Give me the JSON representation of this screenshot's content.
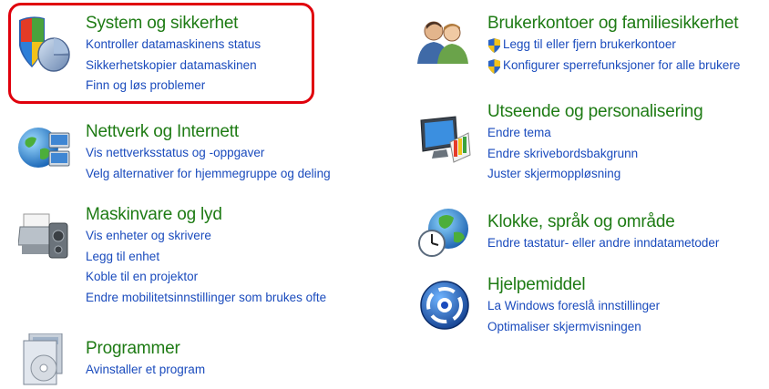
{
  "categories": [
    {
      "id": "system",
      "icon": "shield-icon",
      "title": "System og sikkerhet",
      "links": [
        "Kontroller datamaskinens status",
        "Sikkerhetskopier datamaskinen",
        "Finn og løs problemer"
      ]
    },
    {
      "id": "network",
      "icon": "network-globe-icon",
      "title": "Nettverk og Internett",
      "links": [
        "Vis nettverksstatus og -oppgaver",
        "Velg alternativer for hjemmegruppe og deling"
      ]
    },
    {
      "id": "hardware",
      "icon": "printer-speaker-icon",
      "title": "Maskinvare og lyd",
      "links": [
        "Vis enheter og skrivere",
        "Legg til enhet",
        "Koble til en projektor",
        "Endre mobilitetsinnstillinger som brukes ofte"
      ]
    },
    {
      "id": "programs",
      "icon": "programs-disc-icon",
      "title": "Programmer",
      "links": [
        "Avinstaller et program"
      ]
    },
    {
      "id": "accounts",
      "icon": "users-icon",
      "title": "Brukerkontoer og familiesikkerhet",
      "links": [
        "Legg til eller fjern brukerkontoer",
        "Konfigurer sperrefunksjoner for alle brukere"
      ]
    },
    {
      "id": "appearance",
      "icon": "monitor-palette-icon",
      "title": "Utseende og personalisering",
      "links": [
        "Endre tema",
        "Endre skrivebordsbakgrunn",
        "Juster skjermoppløsning"
      ]
    },
    {
      "id": "clock",
      "icon": "globe-clock-icon",
      "title": "Klokke, språk og område",
      "links": [
        "Endre tastatur- eller andre inndatametoder"
      ]
    },
    {
      "id": "ease",
      "icon": "ease-of-access-icon",
      "title": "Hjelpemiddel",
      "links": [
        "La Windows foreslå innstillinger",
        "Optimaliser skjermvisningen"
      ]
    }
  ],
  "colors": {
    "title": "#1e7b14",
    "link": "#1a4bbd",
    "highlight": "#e0000c"
  }
}
